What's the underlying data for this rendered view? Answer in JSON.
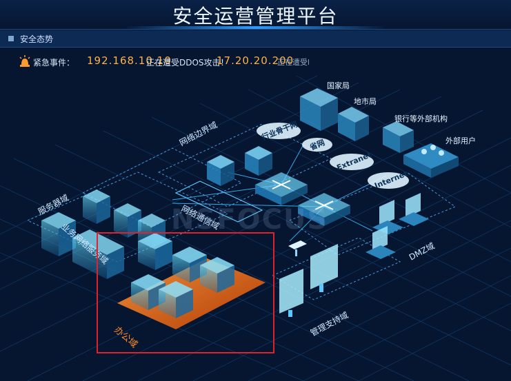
{
  "app": {
    "title": "安全运营管理平台"
  },
  "section": {
    "title": "安全态势"
  },
  "alert": {
    "label": "紧急事件：",
    "events": [
      {
        "ip": "192.168.10.10",
        "message": "正在遭受DDOS攻击！"
      },
      {
        "ip": "17.20.20.200",
        "message": "正在遭受DNS"
      }
    ]
  },
  "diagram": {
    "external": {
      "national_bureau": "国家局",
      "city_bureau": "地市局",
      "bank_orgs": "银行等外部机构",
      "external_users": "外部用户"
    },
    "networks": {
      "industry_backbone": "行业骨干网",
      "province_net": "省网",
      "extranet": "Extranet",
      "internet": "Internet"
    },
    "zones": {
      "network_boundary": "网络边界域",
      "service_zone": "服务器域",
      "business_zone": "业务网络服务域",
      "core_backbone": "网络通信域",
      "dmz": "DMZ域",
      "management": "管理支持域",
      "office": "办公域"
    },
    "watermark": "NSFOCUS"
  },
  "colors": {
    "accent": "#2f9bff",
    "alert_ip": "#ffb347",
    "highlight": "#e0232b",
    "office_zone": "#ff7a1a"
  }
}
